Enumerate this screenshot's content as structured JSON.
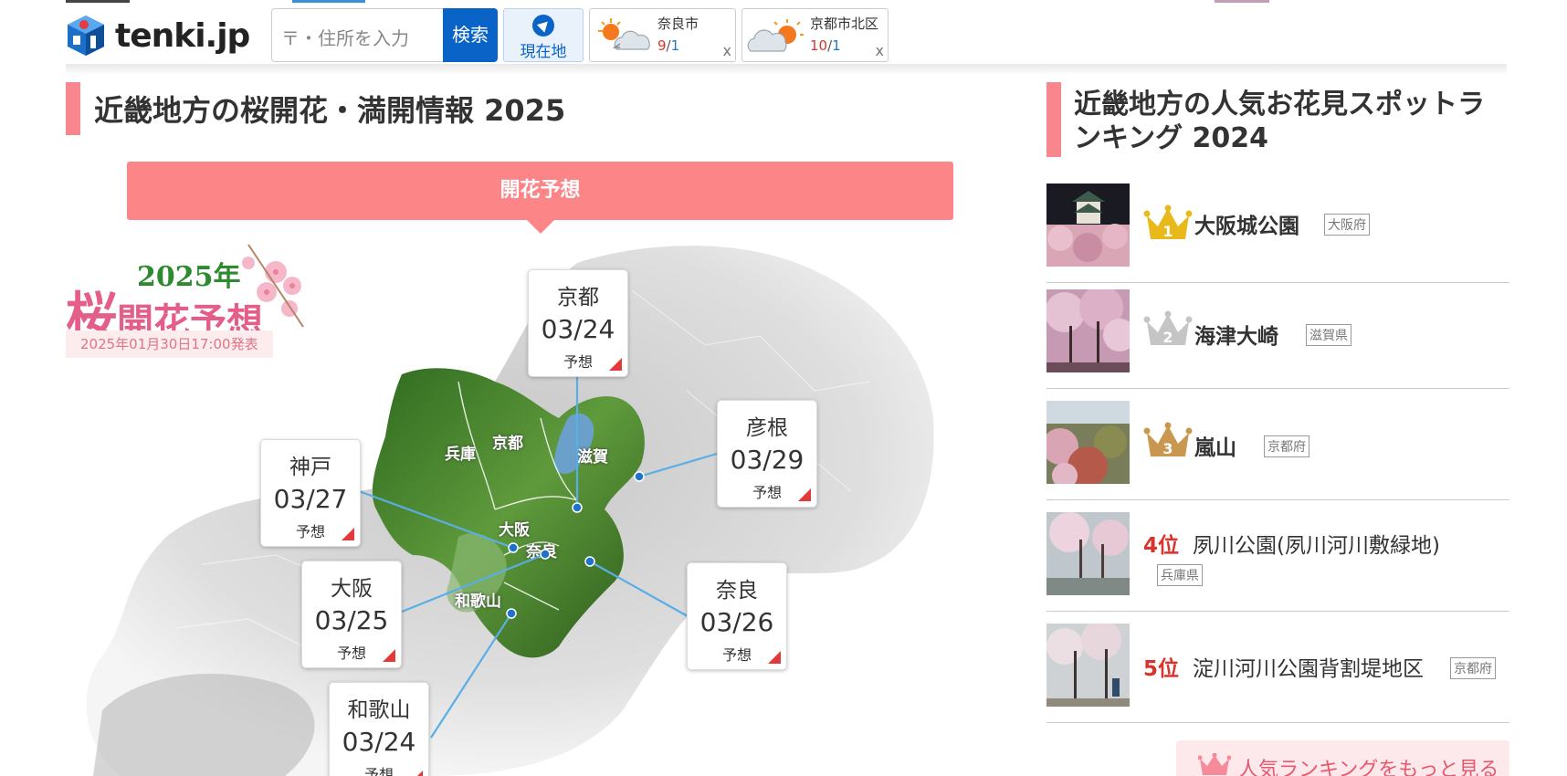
{
  "header": {
    "logo_text": "tenki.jp",
    "search": {
      "placeholder": "〒・住所を入力",
      "button_label": "検索"
    },
    "location_button_label": "現在地",
    "weather_cards": [
      {
        "city": "奈良市",
        "high": "9",
        "low": "1",
        "icon": "sun-and-cloud-icon",
        "close": "x"
      },
      {
        "city": "京都市北区",
        "high": "10",
        "low": "1",
        "icon": "cloud-and-sun-icon",
        "close": "x"
      }
    ]
  },
  "main": {
    "title": "近畿地方の桜開花・満開情報 2025",
    "forecast_banner": "開花予想",
    "badge": {
      "year": "2025年",
      "title_big": "桜",
      "title_rest": "開花予想",
      "issued": "2025年01月30日17:00発表"
    },
    "map_labels": {
      "hyogo": "兵庫",
      "kyoto": "京都",
      "shiga": "滋賀",
      "osaka": "大阪",
      "nara": "奈良",
      "wakayama": "和歌山"
    },
    "cities": [
      {
        "name": "京都",
        "date": "03/24",
        "tag": "予想"
      },
      {
        "name": "彦根",
        "date": "03/29",
        "tag": "予想"
      },
      {
        "name": "神戸",
        "date": "03/27",
        "tag": "予想"
      },
      {
        "name": "大阪",
        "date": "03/25",
        "tag": "予想"
      },
      {
        "name": "奈良",
        "date": "03/26",
        "tag": "予想"
      },
      {
        "name": "和歌山",
        "date": "03/24",
        "tag": "予想"
      }
    ]
  },
  "sidebar": {
    "title_line1": "近畿地方の人気お花見スポットラ",
    "title_line2": "ンキング 2024",
    "ranking": [
      {
        "rank": "1",
        "name": "大阪城公園",
        "pref": "大阪府",
        "crown_color": "#e9b91c"
      },
      {
        "rank": "2",
        "name": "海津大崎",
        "pref": "滋賀県",
        "crown_color": "#c5c5c5"
      },
      {
        "rank": "3",
        "name": "嵐山",
        "pref": "京都府",
        "crown_color": "#c9974f"
      },
      {
        "rank_label": "4位",
        "name": "夙川公園(夙川河川敷緑地)",
        "pref": "兵庫県"
      },
      {
        "rank_label": "5位",
        "name": "淀川河川公園背割堤地区",
        "pref": "京都府"
      }
    ],
    "more_button": "人気ランキングをもっと見る"
  },
  "colors": {
    "accent_pink": "#f7868d",
    "banner_pink": "#fb8587",
    "brand_blue": "#0a63c7",
    "rank_red": "#d9342b"
  }
}
